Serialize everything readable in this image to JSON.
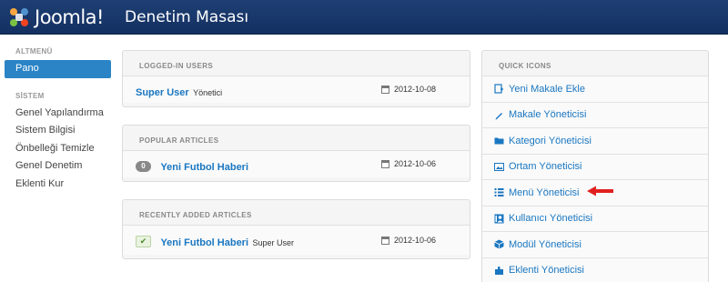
{
  "header": {
    "brand": "Joomla!",
    "title": "Denetim Masası"
  },
  "sidebar": {
    "section1": "ALTMENÜ",
    "items1": [
      {
        "label": "Pano",
        "active": true
      }
    ],
    "section2": "SİSTEM",
    "items2": [
      {
        "label": "Genel Yapılandırma"
      },
      {
        "label": "Sistem Bilgisi"
      },
      {
        "label": "Önbelleği Temizle"
      },
      {
        "label": "Genel Denetim"
      },
      {
        "label": "Eklenti Kur"
      }
    ]
  },
  "logged_in": {
    "title": "LOGGED-IN USERS",
    "user": "Super User",
    "role": "Yönetici",
    "date": "2012-10-08"
  },
  "popular": {
    "title": "POPULAR ARTICLES",
    "hits": "0",
    "article": "Yeni Futbol Haberi",
    "date": "2012-10-06"
  },
  "recent": {
    "title": "RECENTLY ADDED ARTICLES",
    "article": "Yeni Futbol Haberi",
    "author": "Super User",
    "date": "2012-10-06"
  },
  "quick_icons": {
    "title": "QUICK ICONS",
    "items": [
      {
        "label": "Yeni Makale Ekle",
        "icon": "new-article-icon"
      },
      {
        "label": "Makale Yöneticisi",
        "icon": "pencil-icon"
      },
      {
        "label": "Kategori Yöneticisi",
        "icon": "folder-icon"
      },
      {
        "label": "Ortam Yöneticisi",
        "icon": "image-icon"
      },
      {
        "label": "Menü Yöneticisi",
        "icon": "list-icon"
      },
      {
        "label": "Kullanıcı Yöneticisi",
        "icon": "user-icon"
      },
      {
        "label": "Modül Yöneticisi",
        "icon": "cube-icon"
      },
      {
        "label": "Eklenti Yöneticisi",
        "icon": "puzzle-icon"
      }
    ]
  },
  "colors": {
    "header": "#1e3f73",
    "link": "#1a77c1",
    "active": "#2a84c6",
    "arrow": "#e02020"
  }
}
